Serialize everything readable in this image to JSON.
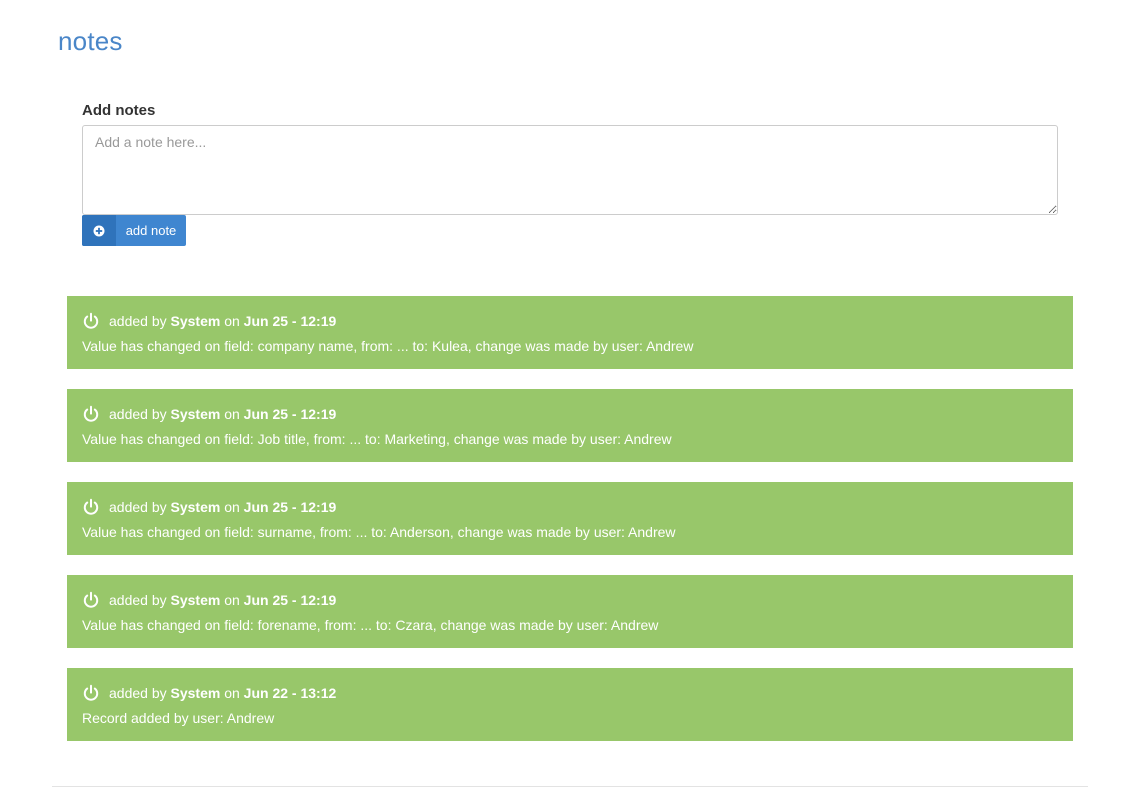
{
  "page": {
    "title": "notes"
  },
  "form": {
    "label": "Add notes",
    "placeholder": "Add a note here...",
    "value": "",
    "button_label": "add note",
    "button_icon": "plus-circle-icon"
  },
  "colors": {
    "title": "#4a86c8",
    "button": "#3f86d0",
    "note_background": "#98c76a"
  },
  "notes": [
    {
      "prefix": "added by",
      "author": "System",
      "on": "on",
      "date": "Jun 25 - 12:19",
      "text": "Value has changed on field: company name, from: ... to: Kulea, change was made by user: Andrew",
      "icon": "power-icon"
    },
    {
      "prefix": "added by",
      "author": "System",
      "on": "on",
      "date": "Jun 25 - 12:19",
      "text": "Value has changed on field: Job title, from: ... to: Marketing, change was made by user: Andrew",
      "icon": "power-icon"
    },
    {
      "prefix": "added by",
      "author": "System",
      "on": "on",
      "date": "Jun 25 - 12:19",
      "text": "Value has changed on field: surname, from: ... to: Anderson, change was made by user: Andrew",
      "icon": "power-icon"
    },
    {
      "prefix": "added by",
      "author": "System",
      "on": "on",
      "date": "Jun 25 - 12:19",
      "text": "Value has changed on field: forename, from: ... to: Czara, change was made by user: Andrew",
      "icon": "power-icon"
    },
    {
      "prefix": "added by",
      "author": "System",
      "on": "on",
      "date": "Jun 22 - 13:12",
      "text": "Record added by user: Andrew",
      "icon": "power-icon"
    }
  ]
}
